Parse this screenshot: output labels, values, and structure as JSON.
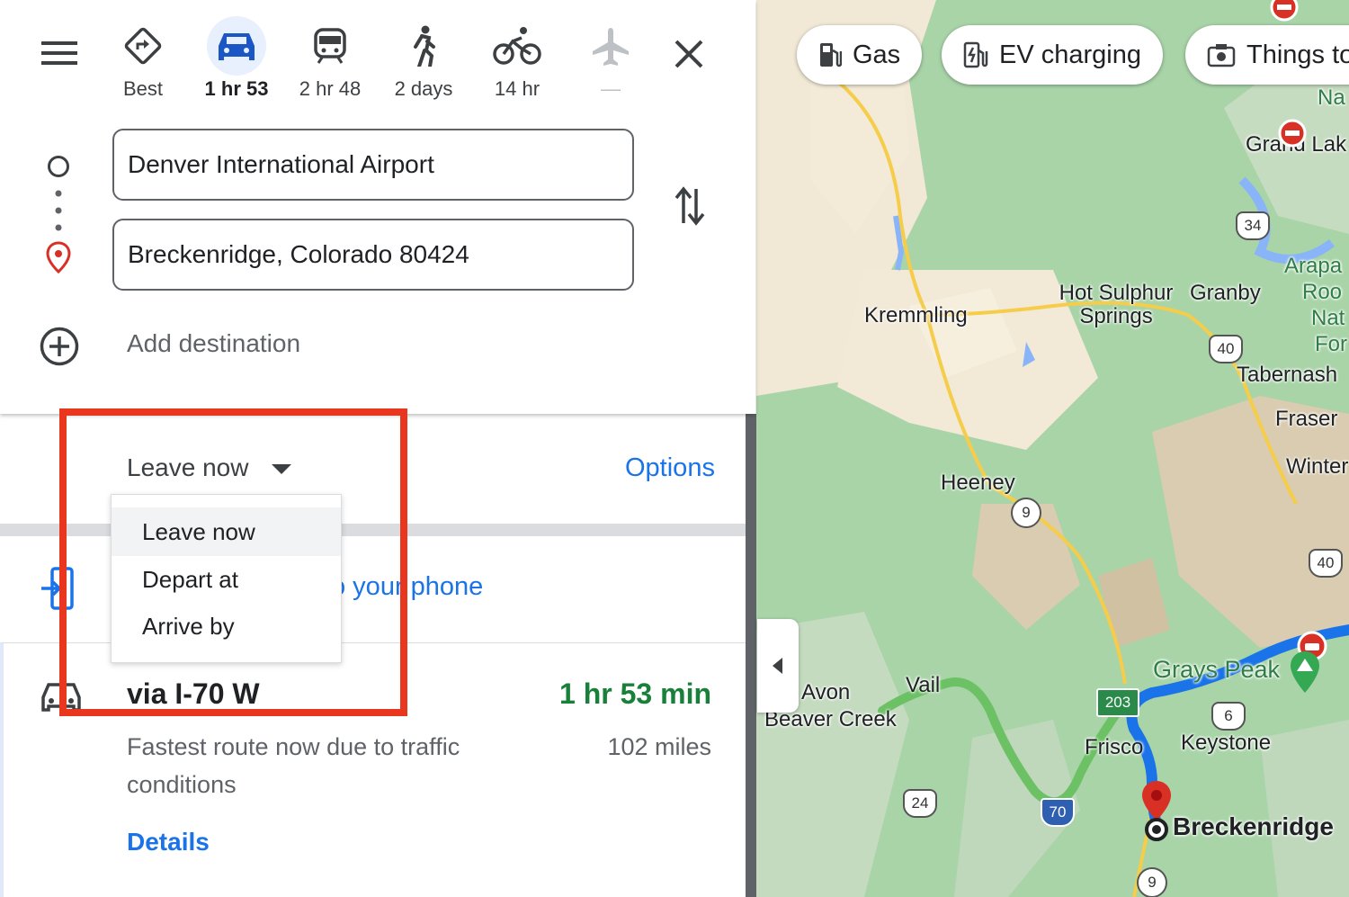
{
  "travel_modes": [
    {
      "name": "best",
      "label": "Best",
      "selected": false,
      "icon": "directions-icon"
    },
    {
      "name": "driving",
      "label": "1 hr 53",
      "selected": true,
      "icon": "car-icon"
    },
    {
      "name": "transit",
      "label": "2 hr 48",
      "selected": false,
      "icon": "train-icon"
    },
    {
      "name": "walking",
      "label": "2 days",
      "selected": false,
      "icon": "walk-icon"
    },
    {
      "name": "cycling",
      "label": "14 hr",
      "selected": false,
      "icon": "bike-icon"
    },
    {
      "name": "flights",
      "label": "—",
      "selected": false,
      "icon": "plane-icon"
    }
  ],
  "origin": "Denver International Airport",
  "destination": "Breckenridge, Colorado 80424",
  "add_destination": "Add destination",
  "timing": {
    "selected": "Leave now",
    "options_link": "Options",
    "dropdown_options": [
      "Leave now",
      "Depart at",
      "Arrive by"
    ]
  },
  "send_to_phone_partial": "o your phone",
  "route": {
    "via": "via I-70 W",
    "duration": "1 hr 53 min",
    "description": "Fastest route now due to traffic conditions",
    "distance": "102 miles",
    "details_link": "Details"
  },
  "map": {
    "chips": [
      "Gas",
      "EV charging",
      "Things to"
    ],
    "places": [
      "Kremmling",
      "Hot Sulphur Springs",
      "Granby",
      "Tabernash",
      "Fraser",
      "Winter",
      "Heeney",
      "Avon",
      "Vail",
      "Beaver Creek",
      "Frisco",
      "Keystone",
      "Breckenridge",
      "Grays Peak",
      "Arapa",
      "Roo",
      "Nat",
      "For",
      "Grand Lak",
      "Na"
    ],
    "shields": [
      "34",
      "40",
      "9",
      "40",
      "203",
      "6",
      "24",
      "70",
      "9"
    ]
  },
  "colors": {
    "accent": "#1a73e8",
    "duration_green": "#188038",
    "highlight_red": "#e8361f"
  }
}
